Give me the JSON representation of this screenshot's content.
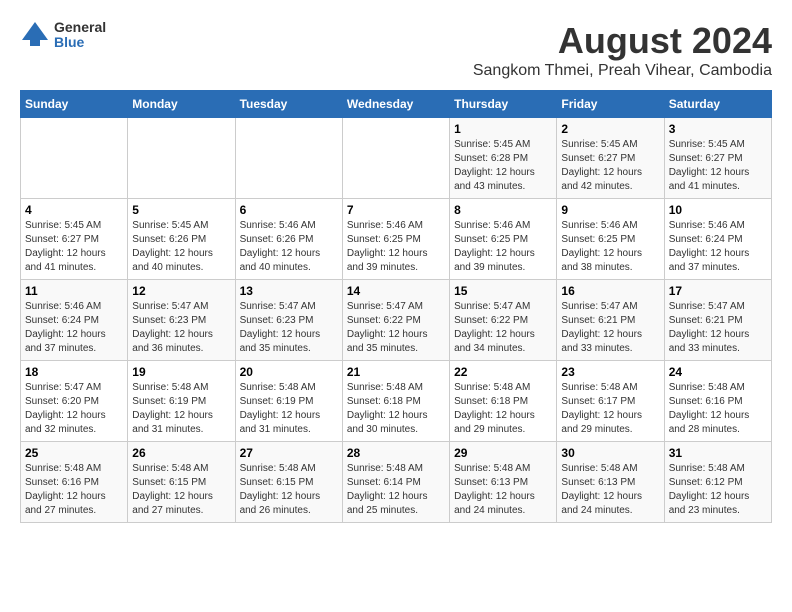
{
  "logo": {
    "general": "General",
    "blue": "Blue"
  },
  "title": "August 2024",
  "subtitle": "Sangkom Thmei, Preah Vihear, Cambodia",
  "days_of_week": [
    "Sunday",
    "Monday",
    "Tuesday",
    "Wednesday",
    "Thursday",
    "Friday",
    "Saturday"
  ],
  "weeks": [
    {
      "days": [
        {
          "number": "",
          "info": ""
        },
        {
          "number": "",
          "info": ""
        },
        {
          "number": "",
          "info": ""
        },
        {
          "number": "",
          "info": ""
        },
        {
          "number": "1",
          "info": "Sunrise: 5:45 AM\nSunset: 6:28 PM\nDaylight: 12 hours\nand 43 minutes."
        },
        {
          "number": "2",
          "info": "Sunrise: 5:45 AM\nSunset: 6:27 PM\nDaylight: 12 hours\nand 42 minutes."
        },
        {
          "number": "3",
          "info": "Sunrise: 5:45 AM\nSunset: 6:27 PM\nDaylight: 12 hours\nand 41 minutes."
        }
      ]
    },
    {
      "days": [
        {
          "number": "4",
          "info": "Sunrise: 5:45 AM\nSunset: 6:27 PM\nDaylight: 12 hours\nand 41 minutes."
        },
        {
          "number": "5",
          "info": "Sunrise: 5:45 AM\nSunset: 6:26 PM\nDaylight: 12 hours\nand 40 minutes."
        },
        {
          "number": "6",
          "info": "Sunrise: 5:46 AM\nSunset: 6:26 PM\nDaylight: 12 hours\nand 40 minutes."
        },
        {
          "number": "7",
          "info": "Sunrise: 5:46 AM\nSunset: 6:25 PM\nDaylight: 12 hours\nand 39 minutes."
        },
        {
          "number": "8",
          "info": "Sunrise: 5:46 AM\nSunset: 6:25 PM\nDaylight: 12 hours\nand 39 minutes."
        },
        {
          "number": "9",
          "info": "Sunrise: 5:46 AM\nSunset: 6:25 PM\nDaylight: 12 hours\nand 38 minutes."
        },
        {
          "number": "10",
          "info": "Sunrise: 5:46 AM\nSunset: 6:24 PM\nDaylight: 12 hours\nand 37 minutes."
        }
      ]
    },
    {
      "days": [
        {
          "number": "11",
          "info": "Sunrise: 5:46 AM\nSunset: 6:24 PM\nDaylight: 12 hours\nand 37 minutes."
        },
        {
          "number": "12",
          "info": "Sunrise: 5:47 AM\nSunset: 6:23 PM\nDaylight: 12 hours\nand 36 minutes."
        },
        {
          "number": "13",
          "info": "Sunrise: 5:47 AM\nSunset: 6:23 PM\nDaylight: 12 hours\nand 35 minutes."
        },
        {
          "number": "14",
          "info": "Sunrise: 5:47 AM\nSunset: 6:22 PM\nDaylight: 12 hours\nand 35 minutes."
        },
        {
          "number": "15",
          "info": "Sunrise: 5:47 AM\nSunset: 6:22 PM\nDaylight: 12 hours\nand 34 minutes."
        },
        {
          "number": "16",
          "info": "Sunrise: 5:47 AM\nSunset: 6:21 PM\nDaylight: 12 hours\nand 33 minutes."
        },
        {
          "number": "17",
          "info": "Sunrise: 5:47 AM\nSunset: 6:21 PM\nDaylight: 12 hours\nand 33 minutes."
        }
      ]
    },
    {
      "days": [
        {
          "number": "18",
          "info": "Sunrise: 5:47 AM\nSunset: 6:20 PM\nDaylight: 12 hours\nand 32 minutes."
        },
        {
          "number": "19",
          "info": "Sunrise: 5:48 AM\nSunset: 6:19 PM\nDaylight: 12 hours\nand 31 minutes."
        },
        {
          "number": "20",
          "info": "Sunrise: 5:48 AM\nSunset: 6:19 PM\nDaylight: 12 hours\nand 31 minutes."
        },
        {
          "number": "21",
          "info": "Sunrise: 5:48 AM\nSunset: 6:18 PM\nDaylight: 12 hours\nand 30 minutes."
        },
        {
          "number": "22",
          "info": "Sunrise: 5:48 AM\nSunset: 6:18 PM\nDaylight: 12 hours\nand 29 minutes."
        },
        {
          "number": "23",
          "info": "Sunrise: 5:48 AM\nSunset: 6:17 PM\nDaylight: 12 hours\nand 29 minutes."
        },
        {
          "number": "24",
          "info": "Sunrise: 5:48 AM\nSunset: 6:16 PM\nDaylight: 12 hours\nand 28 minutes."
        }
      ]
    },
    {
      "days": [
        {
          "number": "25",
          "info": "Sunrise: 5:48 AM\nSunset: 6:16 PM\nDaylight: 12 hours\nand 27 minutes."
        },
        {
          "number": "26",
          "info": "Sunrise: 5:48 AM\nSunset: 6:15 PM\nDaylight: 12 hours\nand 27 minutes."
        },
        {
          "number": "27",
          "info": "Sunrise: 5:48 AM\nSunset: 6:15 PM\nDaylight: 12 hours\nand 26 minutes."
        },
        {
          "number": "28",
          "info": "Sunrise: 5:48 AM\nSunset: 6:14 PM\nDaylight: 12 hours\nand 25 minutes."
        },
        {
          "number": "29",
          "info": "Sunrise: 5:48 AM\nSunset: 6:13 PM\nDaylight: 12 hours\nand 24 minutes."
        },
        {
          "number": "30",
          "info": "Sunrise: 5:48 AM\nSunset: 6:13 PM\nDaylight: 12 hours\nand 24 minutes."
        },
        {
          "number": "31",
          "info": "Sunrise: 5:48 AM\nSunset: 6:12 PM\nDaylight: 12 hours\nand 23 minutes."
        }
      ]
    }
  ]
}
